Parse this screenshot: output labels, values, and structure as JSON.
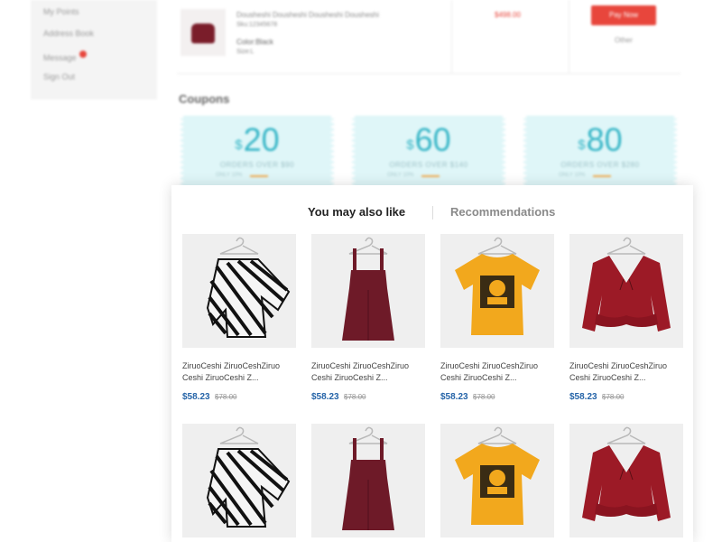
{
  "sidebar": {
    "items": [
      {
        "label": "My Points",
        "badge": false
      },
      {
        "label": "Address Book",
        "badge": false
      },
      {
        "label": "Message",
        "badge": true
      },
      {
        "label": "Sign Out",
        "badge": false
      }
    ]
  },
  "order": {
    "product_name": "Dousheshi Dousheshi Dousheshi Dousheshi",
    "sku": "Sku:12345678",
    "color": "Color:Black",
    "size": "Size:L",
    "price": "$498.00",
    "pay_button": "Pay Now",
    "other_link": "Other"
  },
  "coupons": {
    "title": "Coupons",
    "items": [
      {
        "currency": "$",
        "amount": "20",
        "condition": "ORDERS OVER $90",
        "note": "ONLY 10%"
      },
      {
        "currency": "$",
        "amount": "60",
        "condition": "ORDERS OVER $140",
        "note": "ONLY 10%"
      },
      {
        "currency": "$",
        "amount": "80",
        "condition": "ORDERS OVER $280",
        "note": "ONLY 10%"
      }
    ]
  },
  "recommend": {
    "tabs": [
      {
        "label": "You may also like",
        "active": true
      },
      {
        "label": "Recommendations",
        "active": false
      }
    ],
    "products": [
      {
        "type": "stripe-top",
        "name": "ZiruoCeshi ZiruoCeshZiruo Ceshi ZiruoCeshi Z...",
        "price": "$58.23",
        "old_price": "$78.00"
      },
      {
        "type": "pinafore",
        "name": "ZiruoCeshi ZiruoCeshZiruo Ceshi ZiruoCeshi Z...",
        "price": "$58.23",
        "old_price": "$78.00"
      },
      {
        "type": "yellow-tee",
        "name": "ZiruoCeshi ZiruoCeshZiruo Ceshi ZiruoCeshi Z...",
        "price": "$58.23",
        "old_price": "$78.00"
      },
      {
        "type": "red-blouse",
        "name": "ZiruoCeshi ZiruoCeshZiruo Ceshi ZiruoCeshi Z...",
        "price": "$58.23",
        "old_price": "$78.00"
      },
      {
        "type": "stripe-top",
        "name": "",
        "price": "",
        "old_price": ""
      },
      {
        "type": "pinafore",
        "name": "",
        "price": "",
        "old_price": ""
      },
      {
        "type": "yellow-tee",
        "name": "",
        "price": "",
        "old_price": ""
      },
      {
        "type": "red-blouse",
        "name": "",
        "price": "",
        "old_price": ""
      }
    ]
  },
  "colors": {
    "accent_red": "#e8463c",
    "coupon_bg": "#dff6f8",
    "coupon_text": "#38b6c7",
    "price_blue": "#2564a8",
    "wine": "#6e1a28",
    "mustard": "#f2a81d",
    "crimson": "#9c1a26"
  },
  "icons": [
    "hanger-icon",
    "shirt-icon"
  ]
}
